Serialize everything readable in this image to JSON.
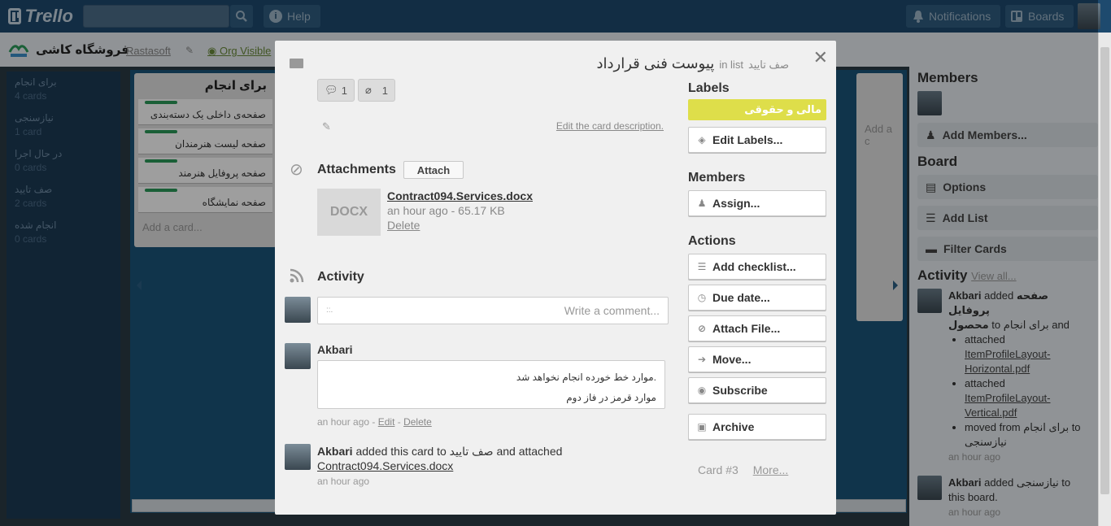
{
  "header": {
    "logo_text": "Trello",
    "help_label": "Help",
    "notifications_label": "Notifications",
    "boards_label": "Boards"
  },
  "boardbar": {
    "title": "فروشگاه کاشی",
    "org": "Rastasoft",
    "visibility": "Org Visible"
  },
  "leftnav": [
    {
      "name": "برای انجام",
      "count": "4 cards"
    },
    {
      "name": "نیازسنجی",
      "count": "1 card"
    },
    {
      "name": "در حال اجرا",
      "count": "0 cards"
    },
    {
      "name": "صف تایید",
      "count": "2 cards"
    },
    {
      "name": "انجام شده",
      "count": "0 cards"
    }
  ],
  "list": {
    "title": "برای انجام",
    "cards": [
      "صفحه‌ی داخلی یک دسته‌بندی",
      "صفحه لیست هنرمندان",
      "صفحه پروفایل هنرمند",
      "صفحه نمایشگاه"
    ],
    "add_card": "Add a card...",
    "add_card_partial": "Add a c"
  },
  "sidebar": {
    "members_title": "Members",
    "add_members": "Add Members...",
    "board_title": "Board",
    "options": "Options",
    "add_list": "Add List",
    "filter_cards": "Filter Cards",
    "activity_title": "Activity",
    "view_all": "View all...",
    "activity": [
      {
        "user": "Akbari",
        "line1_a": "added",
        "line1_b": "صفحه پروفایل",
        "line2_a": "محصول",
        "line2_b": "to",
        "line2_c": "برای انجام",
        "line2_d": "and",
        "bullets": [
          {
            "text": "attached",
            "link": "ItemProfileLayout-Horizontal.pdf"
          },
          {
            "text": "attached",
            "link": "ItemProfileLayout-Vertical.pdf"
          },
          {
            "text": "moved from برای انجام to",
            "link": "نیازسنجی"
          }
        ],
        "time": "an hour ago"
      },
      {
        "user": "Akbari",
        "text": "added نیازسنجی to this board.",
        "time": "an hour ago"
      }
    ]
  },
  "modal": {
    "title": "پیوست فنی قرارداد",
    "in_list_label": "in list",
    "list_name": "صف تایید",
    "comments_count": "1",
    "attachments_count": "1",
    "edit_description": "Edit the card description.",
    "attachments_title": "Attachments",
    "attach_button": "Attach",
    "attachment": {
      "thumb": "DOCX",
      "name": "Contract094.Services.docx",
      "meta": "an hour ago - 65.17 KB",
      "delete": "Delete"
    },
    "activity_title": "Activity",
    "comment_placeholder": "Write a comment...",
    "comment": {
      "author": "Akbari",
      "line1": "موارد خط خورده انجام نخواهد شد.",
      "line2": "موارد قرمز در فاز دوم",
      "time": "an hour ago",
      "edit": "Edit",
      "delete": "Delete"
    },
    "activity_entry": {
      "user": "Akbari",
      "text_a": "added this card to",
      "list": "صف تایید",
      "text_b": "and attached",
      "link": "Contract094.Services.docx",
      "time": "an hour ago"
    },
    "labels_title": "Labels",
    "label_text": "مالی و حقوقی",
    "label_color": "#dede4a",
    "edit_labels": "Edit Labels...",
    "members_title": "Members",
    "assign": "Assign...",
    "actions_title": "Actions",
    "actions": {
      "add_checklist": "Add checklist...",
      "due_date": "Due date...",
      "attach_file": "Attach File...",
      "move": "Move...",
      "subscribe": "Subscribe",
      "archive": "Archive"
    },
    "card_number": "Card #3",
    "more": "More..."
  }
}
